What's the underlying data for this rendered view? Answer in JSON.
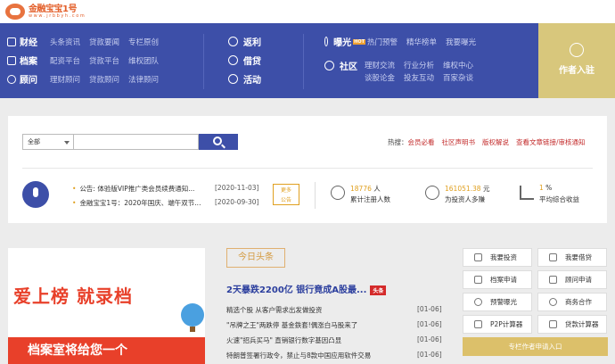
{
  "logo": {
    "name": "金融宝宝1号",
    "url": "w w w . j r b b y h . c o m"
  },
  "nav": {
    "groups": [
      {
        "label": "财经",
        "subs": [
          "头条资讯",
          "贷款要闻",
          "专栏原创"
        ]
      },
      {
        "label": "档案",
        "subs": [
          "配资平台",
          "贷款平台",
          "维权团队"
        ]
      },
      {
        "label": "顾问",
        "subs": [
          "理财顾问",
          "贷款顾问",
          "法律顾问"
        ]
      }
    ],
    "services": [
      {
        "label": "返利"
      },
      {
        "label": "借贷"
      },
      {
        "label": "活动"
      }
    ],
    "exposure": {
      "label": "曝光",
      "badge": "HOT",
      "links": [
        "热门预警",
        "精华榜单",
        "我要曝光"
      ]
    },
    "community": {
      "label": "社区",
      "row1": [
        "理财交流",
        "行业分析",
        "维权中心"
      ],
      "row2": [
        "谈股论金",
        "投友互动",
        "百家杂谈"
      ]
    },
    "author": {
      "label": "作者入驻"
    }
  },
  "search": {
    "category": "全部",
    "placeholder": "",
    "hot_label": "热搜：",
    "hot_links": [
      "会员必看",
      "社区声明书",
      "版权解说",
      "查看文章链接/审核通知"
    ]
  },
  "notices": [
    {
      "text": "公告: 体验版VIP推广类会员续费通知...",
      "date": "[2020-11-03]"
    },
    {
      "text": "金融宝宝1号：2020年国庆、端午双节...",
      "date": "[2020-09-30]"
    }
  ],
  "ad_tag": [
    "更多",
    "公告"
  ],
  "stats": [
    {
      "value": "18776",
      "unit": " 人",
      "label": "累计注册人数"
    },
    {
      "value": "161051.38",
      "unit": " 元",
      "label": "为投资人多赚"
    },
    {
      "value": "1",
      "unit": " %",
      "label": "平均综合收益"
    }
  ],
  "banner": {
    "title": "爱上榜 就录档",
    "subtitle": "档案室将给您一个"
  },
  "news": {
    "tab": "今日头条",
    "headline": "2天暴跌2200亿 银行竟成A股最...",
    "headline_badge": "头条",
    "items": [
      {
        "title": "精选个股 从客户需求出发做投资",
        "date": "[01-06]"
      },
      {
        "title": "\"吊牌之王\"两跌停 基金鉄套!偶涨白马股来了",
        "date": "[01-06]"
      },
      {
        "title": "火速\"招兵买马\" 直销银行数字基因凸显",
        "date": "[01-06]"
      },
      {
        "title": "特朗普签署行政令，禁止与8款中国应用软件交易",
        "date": "[01-06]"
      }
    ]
  },
  "tools": [
    "我要投资",
    "我要借贷",
    "档案申请",
    "顾问申请",
    "预警曝光",
    "商务合作",
    "P2P计算器",
    "贷款计算器"
  ],
  "tools_cta": "专栏作者申请入口",
  "colors": {
    "brand_blue": "#3d4fa8",
    "gold": "#d8c77c",
    "accent_red": "#c32b2b",
    "orange": "#e0a020"
  }
}
